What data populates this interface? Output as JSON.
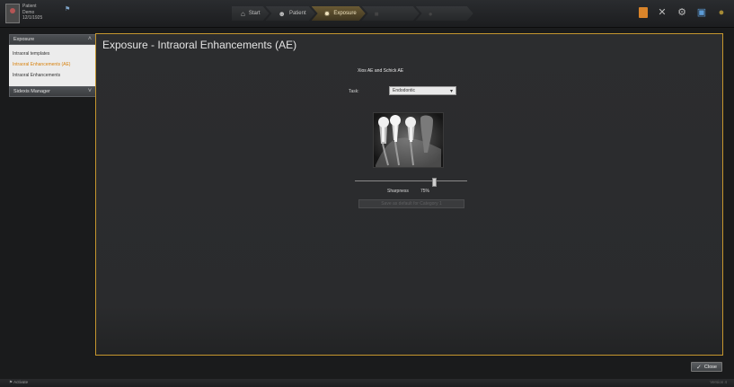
{
  "patient": {
    "line1": "Patient",
    "line2": "Demo",
    "line3": "12/1/1925"
  },
  "wizard": {
    "steps": [
      {
        "label": "Start",
        "icon": "home-icon"
      },
      {
        "label": "Patient",
        "icon": "person-icon"
      },
      {
        "label": "Exposure",
        "icon": "exposure-icon"
      }
    ]
  },
  "toolbar_icons": [
    "book-icon",
    "tools-icon",
    "gear-icon",
    "monitor-icon",
    "globe-icon"
  ],
  "sidebar": {
    "section1": "Exposure",
    "items": [
      {
        "label": "Intraoral templates"
      },
      {
        "label": "Intraoral Enhancements (AE)"
      },
      {
        "label": "Intraoral Enhancements"
      }
    ],
    "section2": "Sidexis Manager"
  },
  "panel": {
    "title": "Exposure  -  Intraoral Enhancements (AE)",
    "heading": "Xios AE and Schick AE",
    "task_label": "Task:",
    "task_value": "Endodontic",
    "sharpness_label": "Sharpness",
    "sharpness_value": "75%",
    "sharpness_level": 0.7,
    "apply_button": "Save as default for Category 1"
  },
  "close_button": "Close",
  "status": {
    "left": "Activate",
    "right": "Version 4"
  },
  "colors": {
    "accent": "#c5962e",
    "active_item": "#d8820e",
    "background": "#1a1b1c"
  }
}
